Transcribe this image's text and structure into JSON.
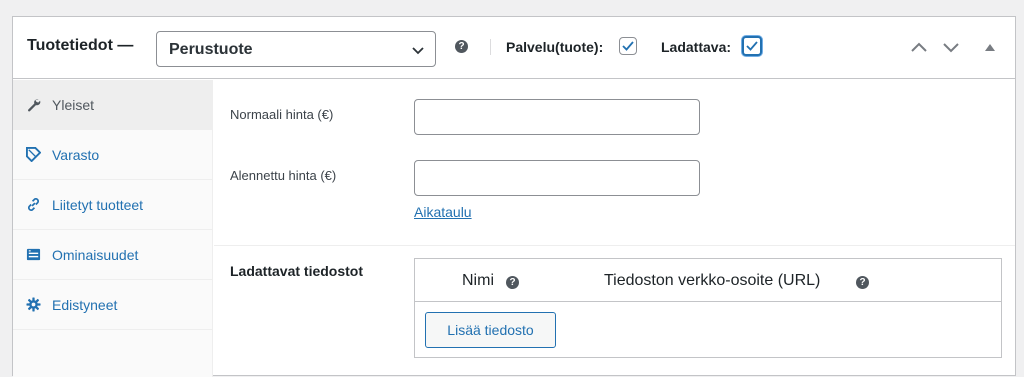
{
  "header": {
    "title": "Tuotetiedot —",
    "product_type": "Perustuote",
    "virtual_label": "Palvelu(tuote):",
    "virtual_checked": true,
    "downloadable_label": "Ladattava:",
    "downloadable_checked": true
  },
  "sidebar": {
    "tabs": [
      {
        "label": "Yleiset",
        "icon": "wrench-icon",
        "active": true
      },
      {
        "label": "Varasto",
        "icon": "tag-icon",
        "active": false
      },
      {
        "label": "Liitetyt tuotteet",
        "icon": "link-icon",
        "active": false
      },
      {
        "label": "Ominaisuudet",
        "icon": "table-icon",
        "active": false
      },
      {
        "label": "Edistyneet",
        "icon": "gear-icon",
        "active": false
      }
    ]
  },
  "general": {
    "regular_price_label": "Normaali hinta (€)",
    "regular_price_value": "",
    "sale_price_label": "Alennettu hinta (€)",
    "sale_price_value": "",
    "schedule_link": "Aikataulu"
  },
  "downloads": {
    "title": "Ladattavat tiedostot",
    "col_name": "Nimi",
    "col_url": "Tiedoston verkko-osoite (URL)",
    "add_button": "Lisää tiedosto"
  },
  "colors": {
    "accent": "#2271b1",
    "border": "#c3c4c7",
    "background": "#f0f0f1"
  }
}
